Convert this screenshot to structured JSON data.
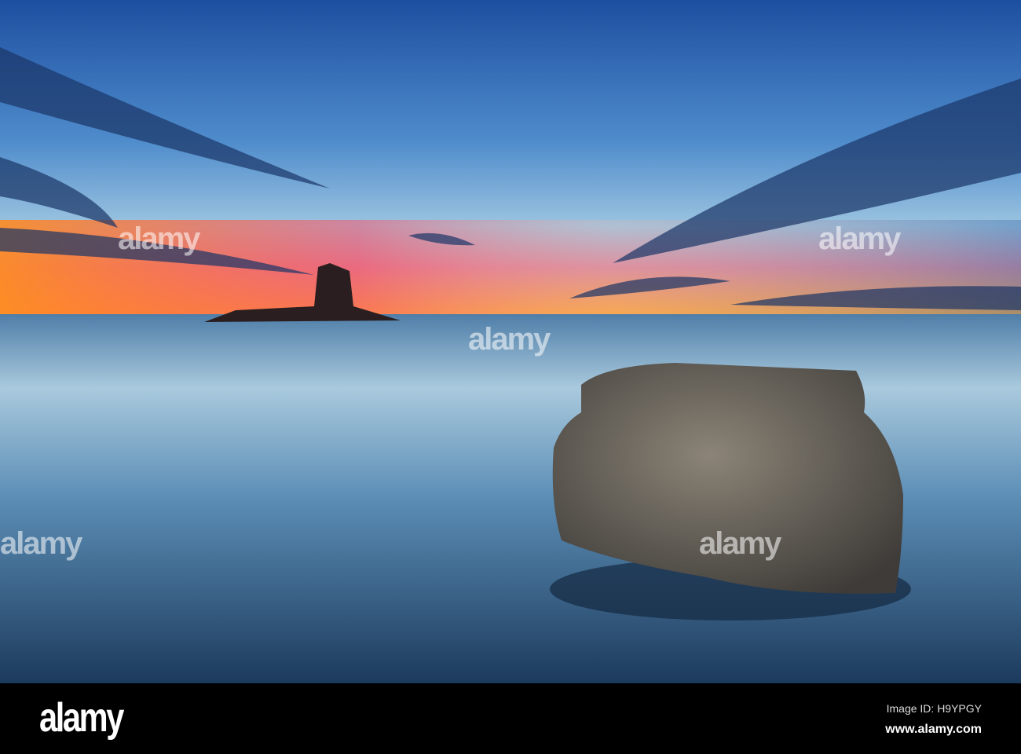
{
  "watermark": {
    "brand": "alamy"
  },
  "footer": {
    "logo": "alamy",
    "image_id": "Image ID: H9YPGY",
    "url": "www.alamy.com"
  }
}
